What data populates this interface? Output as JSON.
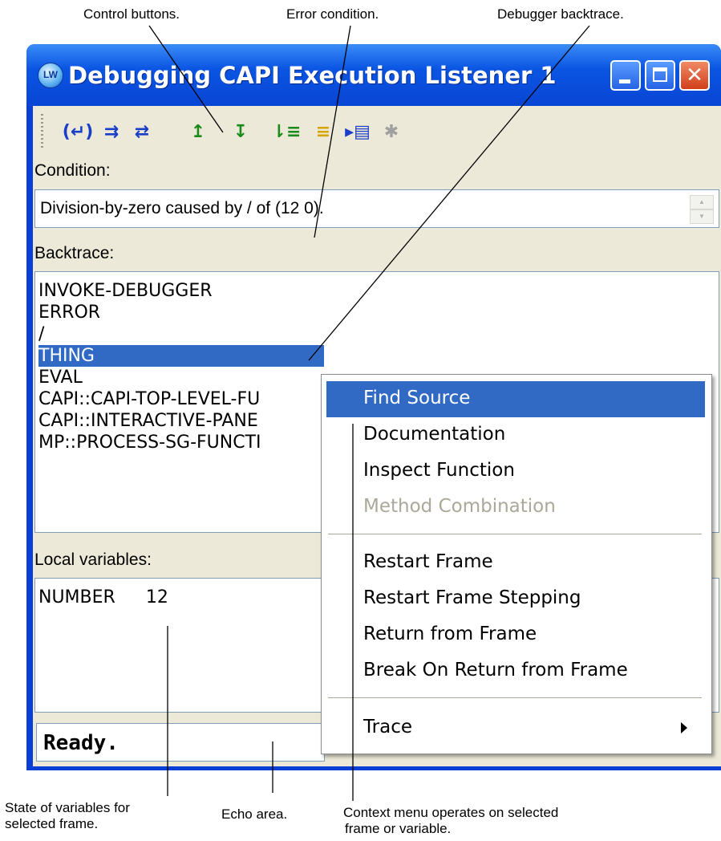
{
  "annotations": {
    "control_buttons": "Control buttons.",
    "error_condition": "Error condition.",
    "debugger_backtrace": "Debugger backtrace.",
    "state_of_variables_line1": "State of variables for",
    "state_of_variables_line2": "selected frame.",
    "echo_area": "Echo area.",
    "context_menu_line1": "Context menu operates on selected",
    "context_menu_line2": "frame or variable."
  },
  "window": {
    "title": "Debugging CAPI Execution Listener 1",
    "icon_text": "LW",
    "close_glyph": "✕"
  },
  "toolbar": {
    "buttons": [
      {
        "glyph": "(↵)",
        "color": "#1a3ec8"
      },
      {
        "glyph": "⇉",
        "color": "#1a3ec8"
      },
      {
        "glyph": "⇄",
        "color": "#1a3ec8"
      },
      {
        "glyph": "↥",
        "color": "#1a8a1a"
      },
      {
        "glyph": "↧",
        "color": "#1a8a1a"
      },
      {
        "glyph": "⇂≡",
        "color": "#1a8a1a"
      },
      {
        "glyph": "≡",
        "color": "#d6a400"
      },
      {
        "glyph": "▸▤",
        "color": "#1a3ec8"
      },
      {
        "glyph": "✱",
        "color": "#a0a0a0"
      }
    ]
  },
  "condition": {
    "label": "Condition:",
    "value": "Division-by-zero caused by / of (12 0)."
  },
  "backtrace": {
    "label": "Backtrace:",
    "frames": [
      "INVOKE-DEBUGGER",
      "ERROR",
      "/",
      "THING",
      "EVAL",
      "CAPI::CAPI-TOP-LEVEL-FU",
      "CAPI::INTERACTIVE-PANE",
      "MP::PROCESS-SG-FUNCTI"
    ],
    "selected_index": 3
  },
  "locals": {
    "label": "Local variables:",
    "variables": [
      {
        "name": "NUMBER",
        "value": "12"
      }
    ]
  },
  "echo_area": {
    "text": "Ready."
  },
  "context_menu": {
    "items": [
      {
        "label": "Find Source",
        "state": "highlighted"
      },
      {
        "label": "Documentation",
        "state": "enabled"
      },
      {
        "label": "Inspect Function",
        "state": "enabled"
      },
      {
        "label": "Method Combination",
        "state": "disabled"
      },
      {
        "label": "Restart Frame",
        "state": "enabled"
      },
      {
        "label": "Restart Frame Stepping",
        "state": "enabled"
      },
      {
        "label": "Return from Frame",
        "state": "enabled"
      },
      {
        "label": "Break On Return from Frame",
        "state": "enabled"
      },
      {
        "label": "Trace",
        "state": "submenu"
      }
    ]
  },
  "colors": {
    "title_bar": "#0b55e3",
    "selection": "#316ac5",
    "client_bg": "#ece9d8",
    "disabled_text": "#aca899"
  }
}
